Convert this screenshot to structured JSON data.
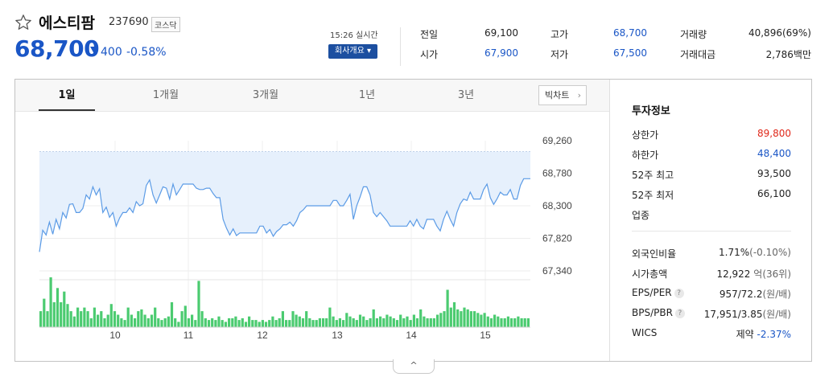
{
  "stock": {
    "name": "에스티팜",
    "code": "237690",
    "market": "코스닥",
    "price": "68,700",
    "change": "400",
    "change_rate": "-0.58%",
    "direction": "down",
    "realtime": "15:26 실시간",
    "company_button": "회사개요 ▾"
  },
  "stats": [
    {
      "label": "전일",
      "value": "69,100",
      "color": "#222222"
    },
    {
      "label": "고가",
      "value": "68,700",
      "color": "#1a56c6"
    },
    {
      "label": "거래량",
      "value": "40,896(69%)",
      "color": "#222222"
    },
    {
      "label": "시가",
      "value": "67,900",
      "color": "#1a56c6"
    },
    {
      "label": "저가",
      "value": "67,500",
      "color": "#1a56c6"
    },
    {
      "label": "거래대금",
      "value": "2,786백만",
      "color": "#222222"
    }
  ],
  "tabs": [
    "1일",
    "1개월",
    "3개월",
    "1년",
    "3년"
  ],
  "active_tab": "1일",
  "big_chart_label": "빅차트",
  "chart_data": {
    "type": "area",
    "ylim": [
      67340,
      69260
    ],
    "y_ticks": [
      "69,260",
      "68,780",
      "68,300",
      "67,820",
      "67,340"
    ],
    "x_ticks": [
      "10",
      "11",
      "12",
      "13",
      "14",
      "15"
    ],
    "reference_line": 69100,
    "series": [
      {
        "values": [
          67620,
          67940,
          67870,
          68060,
          67880,
          68100,
          67960,
          68200,
          68120,
          68320,
          68330,
          68200,
          68200,
          68260,
          68460,
          68400,
          68580,
          68460,
          68550,
          68200,
          68280,
          68130,
          68200,
          68000,
          68120,
          68200,
          68200,
          68270,
          68200,
          68360,
          68300,
          68330,
          68600,
          68680,
          68460,
          68340,
          68460,
          68580,
          68560,
          68400,
          68620,
          68460,
          68540,
          68620,
          68620,
          68620,
          68620,
          68560,
          68540,
          68540,
          68560,
          68560,
          68480,
          68420,
          68420,
          68100,
          67970,
          67870,
          67960,
          67860,
          67900,
          67900,
          67900,
          67900,
          67900,
          67900,
          68000,
          68000,
          67900,
          67950,
          67850,
          67920,
          67960,
          68020,
          68020,
          68060,
          68000,
          68080,
          68200,
          68240,
          68300,
          68300,
          68300,
          68300,
          68300,
          68300,
          68300,
          68300,
          68380,
          68380,
          68300,
          68300,
          68380,
          68470,
          68100,
          68300,
          68430,
          68580,
          68580,
          68460,
          68200,
          68140,
          68200,
          68140,
          68080,
          68000,
          68000,
          68000,
          68000,
          68000,
          68000,
          68080,
          68000,
          68100,
          68000,
          67960,
          68100,
          68100,
          68100,
          68000,
          67930,
          68100,
          68220,
          68100,
          68000,
          68200,
          68330,
          68400,
          68380,
          68500,
          68400,
          68400,
          68400,
          68540,
          68620,
          68420,
          68320,
          68400,
          68500,
          68460,
          68460,
          68540,
          68400,
          68400,
          68600,
          68700,
          68700,
          68700
        ]
      }
    ],
    "volume": [
      9,
      16,
      9,
      28,
      14,
      22,
      14,
      20,
      13,
      9,
      6,
      11,
      9,
      11,
      9,
      5,
      11,
      7,
      9,
      5,
      7,
      13,
      9,
      7,
      5,
      4,
      11,
      7,
      5,
      9,
      10,
      7,
      5,
      7,
      11,
      5,
      4,
      5,
      6,
      14,
      5,
      3,
      9,
      12,
      5,
      7,
      4,
      26,
      9,
      5,
      4,
      5,
      4,
      6,
      4,
      3,
      5,
      5,
      6,
      4,
      5,
      3,
      6,
      4,
      4,
      3,
      4,
      3,
      4,
      6,
      4,
      5,
      9,
      4,
      4,
      9,
      7,
      6,
      5,
      9,
      5,
      4,
      4,
      5,
      5,
      5,
      11,
      6,
      4,
      5,
      4,
      8,
      6,
      5,
      4,
      7,
      6,
      4,
      5,
      10,
      5,
      6,
      5,
      7,
      6,
      5,
      4,
      7,
      5,
      6,
      4,
      7,
      5,
      10,
      6,
      5,
      5,
      5,
      7,
      8,
      9,
      21,
      11,
      14,
      10,
      9,
      11,
      10,
      9,
      9,
      8,
      7,
      8,
      6,
      5,
      7,
      6,
      5,
      5,
      6,
      5,
      5,
      6,
      5,
      5,
      5
    ]
  },
  "investment_info": {
    "title": "투자정보",
    "rows": [
      {
        "label": "상한가",
        "value": "89,800",
        "color": "red"
      },
      {
        "label": "하한가",
        "value": "48,400",
        "color": "blue"
      },
      {
        "label": "52주 최고",
        "value": "93,500",
        "color": ""
      },
      {
        "label": "52주 최저",
        "value": "66,100",
        "color": ""
      },
      {
        "label": "업종",
        "value": "",
        "color": ""
      }
    ],
    "rows2": [
      {
        "label": "외국인비율",
        "value": "1.71%",
        "sub": "(-0.10%)"
      },
      {
        "label": "시가총액",
        "value": "12,922",
        "sub": "억(36위)"
      },
      {
        "label": "EPS/PER",
        "value": "957/72.2",
        "sub": "(원/배)",
        "help": "?"
      },
      {
        "label": "BPS/PBR",
        "value": "17,951/3.85",
        "sub": "(원/배)",
        "help": "?"
      },
      {
        "label": "WICS",
        "value": "제약",
        "sub": "-2.37%"
      }
    ]
  },
  "collapse_icon": "^"
}
